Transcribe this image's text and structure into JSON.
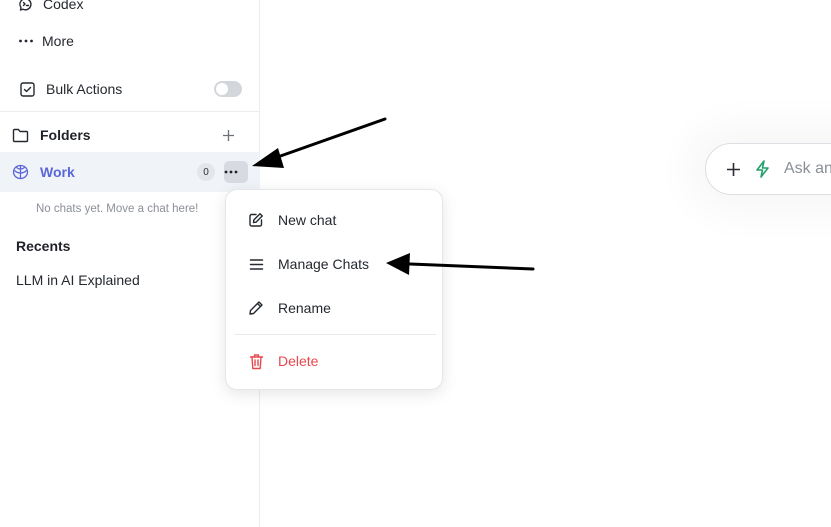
{
  "sidebar": {
    "nav": [
      {
        "label": "Codex",
        "icon": "codex-icon"
      },
      {
        "label": "More",
        "icon": "more-dots-icon"
      }
    ],
    "bulk_actions": {
      "label": "Bulk Actions",
      "enabled": false
    },
    "folders": {
      "heading": "Folders",
      "items": [
        {
          "label": "Work",
          "count": "0",
          "icon": "brain-icon"
        }
      ],
      "empty_note": "No chats yet. Move a chat here!"
    },
    "recents": {
      "heading": "Recents",
      "items": [
        {
          "label": "LLM in AI Explained"
        }
      ]
    }
  },
  "context_menu": {
    "items": [
      {
        "label": "New chat",
        "icon": "edit-icon"
      },
      {
        "label": "Manage Chats",
        "icon": "menu-lines-icon"
      },
      {
        "label": "Rename",
        "icon": "pencil-icon"
      },
      {
        "label": "Delete",
        "icon": "trash-icon"
      }
    ]
  },
  "composer": {
    "placeholder": "Ask an"
  },
  "colors": {
    "accent": "#5a67d8",
    "danger": "#e5484d",
    "bolt": "#22a06b"
  }
}
